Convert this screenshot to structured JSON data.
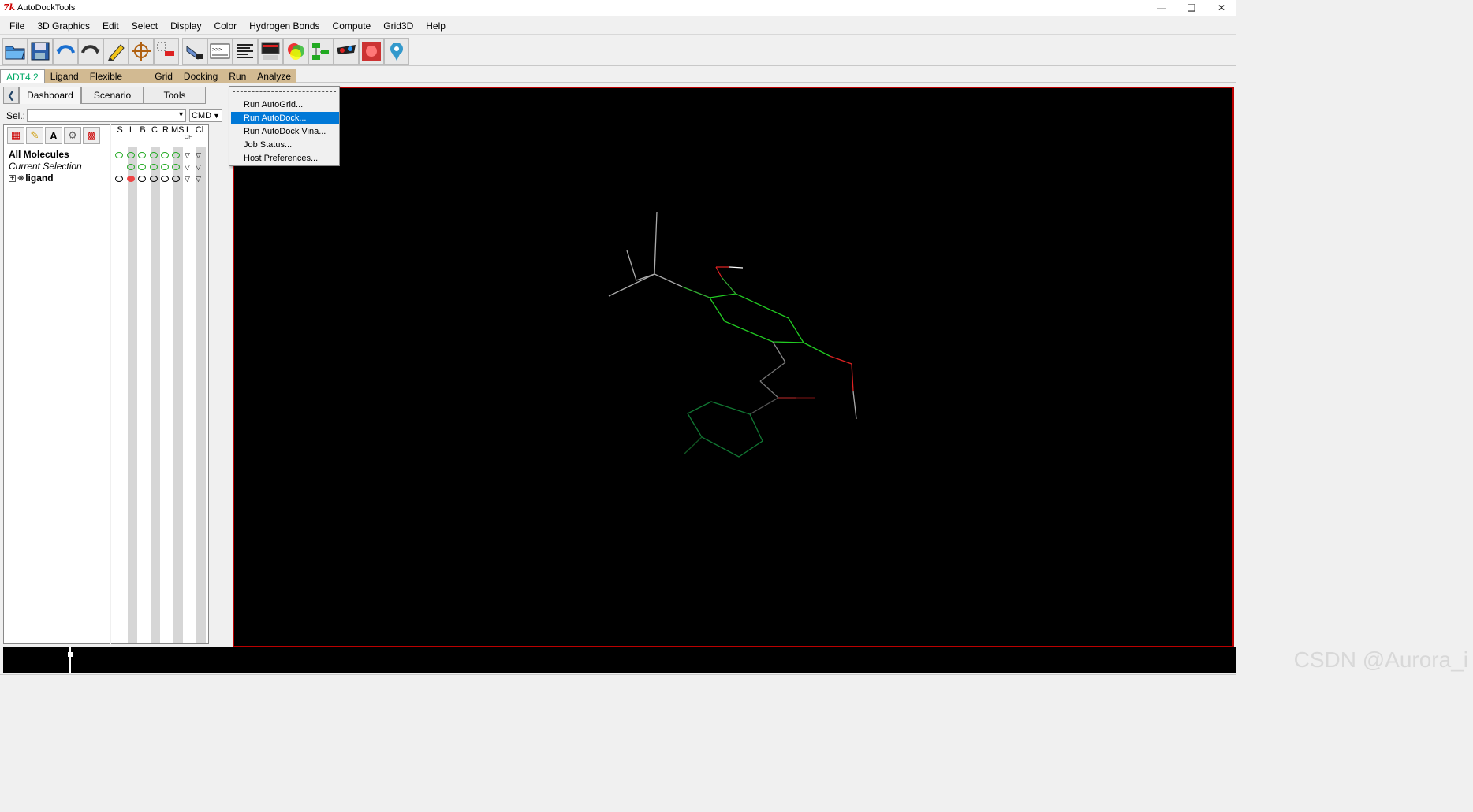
{
  "window": {
    "title": "AutoDockTools",
    "app_icon": "tk-feather-icon"
  },
  "menubar": [
    "File",
    "3D Graphics",
    "Edit",
    "Select",
    "Display",
    "Color",
    "Hydrogen Bonds",
    "Compute",
    "Grid3D",
    "Help"
  ],
  "toolbar": {
    "icons": [
      "open-folder-icon",
      "save-icon",
      "undo-icon",
      "redo-icon",
      "pick-pencil-icon",
      "center-target-icon",
      "select-molecule-icon",
      "hand-pointer-icon",
      "python-shell-icon",
      "align-text-icon",
      "monitor-icon",
      "color-sphere-icon",
      "graph-tree-icon",
      "stereo-glasses-icon",
      "fog-cube-icon",
      "help-marker-icon"
    ]
  },
  "plugin_tabs": [
    "ADT4.2",
    "Ligand",
    "Flexible Residues",
    "Grid",
    "Docking",
    "Run",
    "Analyze"
  ],
  "dashboard": {
    "tabs": [
      "Dashboard",
      "Scenario",
      "Tools"
    ],
    "sel_label": "Sel.:",
    "cmd_label": "CMD",
    "columns": [
      "S",
      "L",
      "B",
      "C",
      "R",
      "MS",
      "L",
      "Cl"
    ],
    "column_sub": [
      "",
      "",
      "",
      "",
      "",
      "",
      "OH",
      ""
    ],
    "tree": {
      "all_molecules": "All Molecules",
      "current_selection": "Current Selection",
      "ligand": "ligand"
    }
  },
  "run_menu": {
    "items": [
      "Run AutoGrid...",
      "Run AutoDock...",
      "Run AutoDock Vina...",
      "Job Status...",
      "Host Preferences..."
    ],
    "highlighted": "Run AutoDock..."
  },
  "colors": {
    "accent": "#0078d7",
    "viewer_border": "#bb0000",
    "plugin_bar": "#d2ba92"
  },
  "watermark": "CSDN @Aurora_i"
}
